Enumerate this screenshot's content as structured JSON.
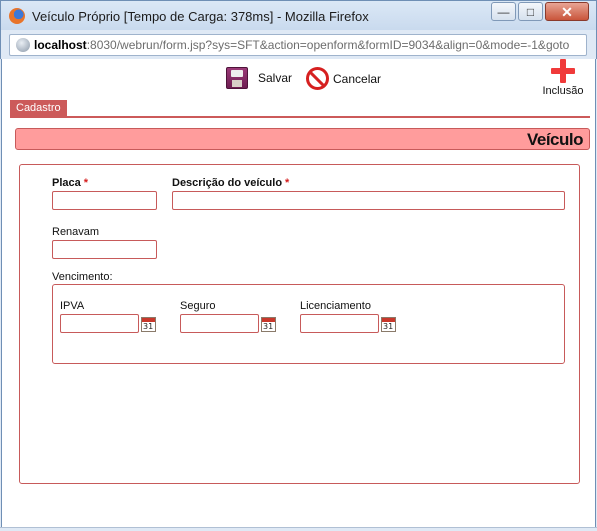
{
  "window": {
    "title": "Veículo Próprio [Tempo de Carga: 378ms] - Mozilla Firefox",
    "minimize": "—",
    "maximize": "□",
    "close": "✕",
    "icon": "firefox-icon"
  },
  "address_bar": {
    "host": "localhost",
    "rest": ":8030/webrun/form.jsp?sys=SFT&action=openform&formID=9034&align=0&mode=-1&goto",
    "icon": "globe-icon"
  },
  "toolbar": {
    "save_label": "Salvar",
    "cancel_label": "Cancelar",
    "add_label": "Inclusão",
    "save_icon": "floppy-disk-icon",
    "cancel_icon": "stop-icon",
    "add_icon": "plus-icon"
  },
  "tabs": [
    {
      "label": "Cadastro"
    }
  ],
  "form": {
    "title": "Veículo",
    "fields": {
      "placa": {
        "label": "Placa",
        "required": "*",
        "value": ""
      },
      "descricao": {
        "label": "Descrição do veículo",
        "required": "*",
        "value": ""
      },
      "renavam": {
        "label": "Renavam",
        "value": ""
      }
    },
    "vencimento": {
      "label": "Vencimento:",
      "fields": [
        {
          "label": "IPVA",
          "value": ""
        },
        {
          "label": "Seguro",
          "value": ""
        },
        {
          "label": "Licenciamento",
          "value": ""
        }
      ],
      "calendar_icon": "calendar-icon",
      "calendar_day": "31"
    }
  },
  "colors": {
    "accent": "#cc5a5a",
    "header_band": "#ff9c9c",
    "required_star": "#d41c1c"
  }
}
